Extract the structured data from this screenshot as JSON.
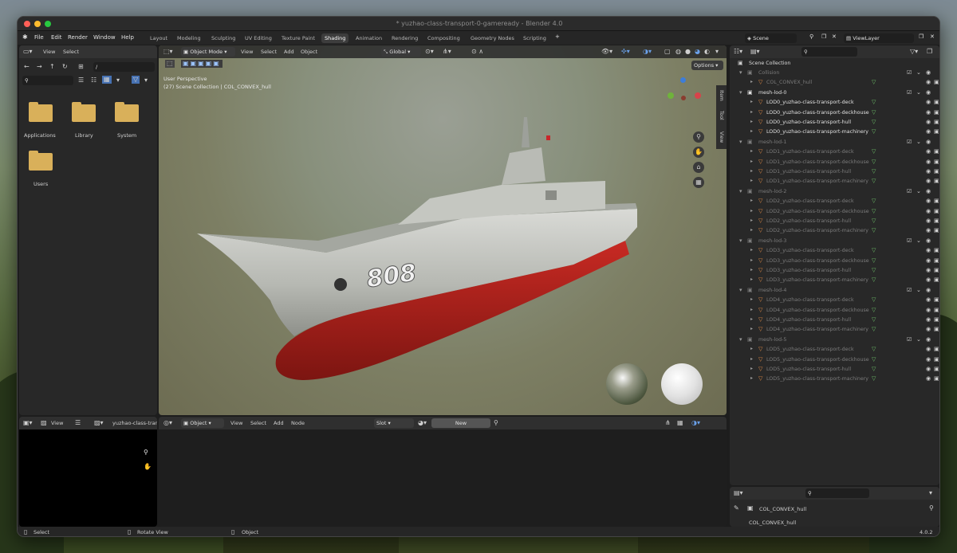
{
  "window": {
    "title": "* yuzhao-class-transport-0-gameready - Blender 4.0"
  },
  "menu": [
    "File",
    "Edit",
    "Render",
    "Window",
    "Help"
  ],
  "workspaces": [
    {
      "label": "Layout",
      "active": false
    },
    {
      "label": "Modeling",
      "active": false
    },
    {
      "label": "Sculpting",
      "active": false
    },
    {
      "label": "UV Editing",
      "active": false
    },
    {
      "label": "Texture Paint",
      "active": false
    },
    {
      "label": "Shading",
      "active": true
    },
    {
      "label": "Animation",
      "active": false
    },
    {
      "label": "Rendering",
      "active": false
    },
    {
      "label": "Compositing",
      "active": false
    },
    {
      "label": "Geometry Nodes",
      "active": false
    },
    {
      "label": "Scripting",
      "active": false
    }
  ],
  "scene": {
    "name": "Scene",
    "view_layer": "ViewLayer"
  },
  "filebrowser": {
    "menu_view": "View",
    "menu_select": "Select",
    "path": "/",
    "items": [
      "Applications",
      "Library",
      "System",
      "Users"
    ]
  },
  "viewport": {
    "mode": "Object Mode",
    "menu": [
      "View",
      "Select",
      "Add",
      "Object"
    ],
    "orientation": "Global",
    "options": "Options",
    "overlay_title": "User Perspective",
    "overlay_sub": "(27) Scene Collection | COL_CONVEX_hull",
    "side_tabs": [
      "Item",
      "Tool",
      "View"
    ],
    "hull_number": "808"
  },
  "outliner": {
    "root": "Scene Collection",
    "collections": [
      {
        "name": "Collision",
        "faded": true,
        "items": [
          "COL_CONVEX_hull"
        ]
      },
      {
        "name": "mesh-lod-0",
        "faded": false,
        "items": [
          "LOD0_yuzhao-class-transport-deck",
          "LOD0_yuzhao-class-transport-deckhouse",
          "LOD0_yuzhao-class-transport-hull",
          "LOD0_yuzhao-class-transport-machinery"
        ]
      },
      {
        "name": "mesh-lod-1",
        "faded": true,
        "items": [
          "LOD1_yuzhao-class-transport-deck",
          "LOD1_yuzhao-class-transport-deckhouse",
          "LOD1_yuzhao-class-transport-hull",
          "LOD1_yuzhao-class-transport-machinery"
        ]
      },
      {
        "name": "mesh-lod-2",
        "faded": true,
        "items": [
          "LOD2_yuzhao-class-transport-deck",
          "LOD2_yuzhao-class-transport-deckhouse",
          "LOD2_yuzhao-class-transport-hull",
          "LOD2_yuzhao-class-transport-machinery"
        ]
      },
      {
        "name": "mesh-lod-3",
        "faded": true,
        "items": [
          "LOD3_yuzhao-class-transport-deck",
          "LOD3_yuzhao-class-transport-deckhouse",
          "LOD3_yuzhao-class-transport-hull",
          "LOD3_yuzhao-class-transport-machinery"
        ]
      },
      {
        "name": "mesh-lod-4",
        "faded": true,
        "items": [
          "LOD4_yuzhao-class-transport-deck",
          "LOD4_yuzhao-class-transport-deckhouse",
          "LOD4_yuzhao-class-transport-hull",
          "LOD4_yuzhao-class-transport-machinery"
        ]
      },
      {
        "name": "mesh-lod-5",
        "faded": true,
        "items": [
          "LOD5_yuzhao-class-transport-deck",
          "LOD5_yuzhao-class-transport-deckhouse",
          "LOD5_yuzhao-class-transport-hull",
          "LOD5_yuzhao-class-transport-machinery"
        ]
      }
    ]
  },
  "properties": {
    "object": "COL_CONVEX_hull",
    "object_sub": "COL_CONVEX_hull"
  },
  "image_editor": {
    "view": "View",
    "name": "yuzhao-class-trar"
  },
  "node_editor": {
    "object": "Object",
    "menu": [
      "View",
      "Select",
      "Add",
      "Node"
    ],
    "slot": "Slot",
    "new": "New"
  },
  "status": {
    "select": "Select",
    "rotate": "Rotate View",
    "object": "Object",
    "version": "4.0.2"
  }
}
